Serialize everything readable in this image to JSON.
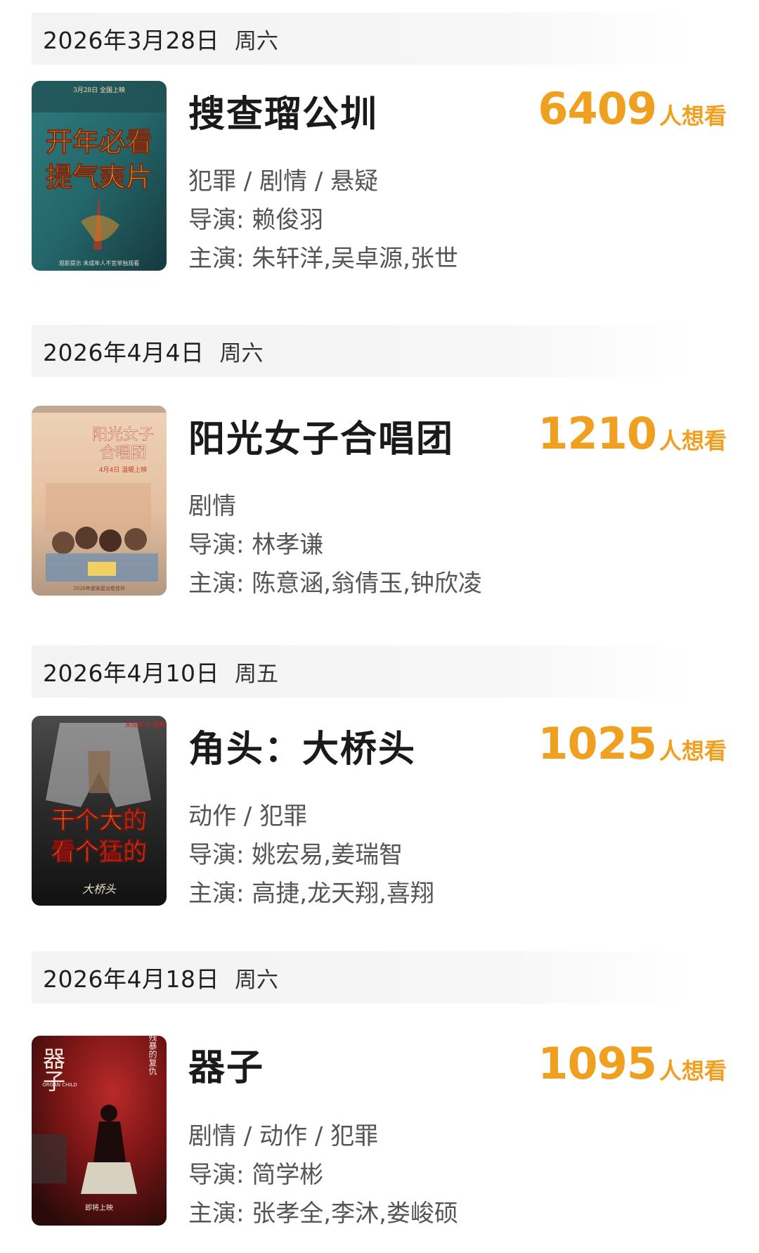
{
  "labels": {
    "wish_suffix": "人想看",
    "director_prefix": "导演: ",
    "cast_prefix": "主演: "
  },
  "colors": {
    "accent": "#f0a021",
    "date_bar_bg": "#f3f3f3",
    "secondary_text": "#555555"
  },
  "movies": [
    {
      "date": "2026年3月28日",
      "weekday": "周六",
      "title": "搜查瑠公圳",
      "wish_count": "6409",
      "genre": "犯罪 / 剧情 / 悬疑",
      "director": "赖俊羽",
      "cast": "朱轩洋,吴卓源,张世",
      "poster": {
        "tagline_1": "开年必看",
        "tagline_2": "提气爽片",
        "header": "3月28日 全国上映",
        "footer": "观影提示 未成年人不宜单独观看",
        "colors": [
          "#2a6f72",
          "#d9b13a",
          "#1d3f44"
        ]
      }
    },
    {
      "date": "2026年4月4日",
      "weekday": "周六",
      "title": "阳光女子合唱团",
      "wish_count": "1210",
      "genre": "剧情",
      "director": "林孝谦",
      "cast": "陈意涵,翁倩玉,钟欣凌",
      "poster": {
        "tagline_1": "阳光女子",
        "tagline_2": "合唱团",
        "header": "4月4日 温暖上映",
        "footer": "2026年度家庭治愈佳作",
        "colors": [
          "#e9c7a8",
          "#c7452e",
          "#b9a58a"
        ]
      }
    },
    {
      "date": "2026年4月10日",
      "weekday": "周五",
      "title": "角头：大桥头",
      "wish_count": "1025",
      "genre": "动作 / 犯罪",
      "director": "姚宏易,姜瑞智",
      "cast": "高捷,龙天翔,喜翔",
      "poster": {
        "tagline_1": "干个大的",
        "tagline_2": "看个猛的",
        "header": "未成年人 谨慎观看",
        "footer": "大桥头",
        "colors": [
          "#3a3a3a",
          "#f2c21b",
          "#c7221d"
        ]
      }
    },
    {
      "date": "2026年4月18日",
      "weekday": "周六",
      "title": "器子",
      "wish_count": "1095",
      "genre": "剧情 / 动作 / 犯罪",
      "director": "简学彬",
      "cast": "张孝全,李沐,娄峻硕",
      "poster": {
        "tagline_1": "器子",
        "tagline_2": "最残暴的复仇",
        "header": "ORGAN CHILD",
        "footer": "即将上映",
        "colors": [
          "#8e1a1a",
          "#2a1010",
          "#d8d0c0"
        ]
      }
    }
  ]
}
